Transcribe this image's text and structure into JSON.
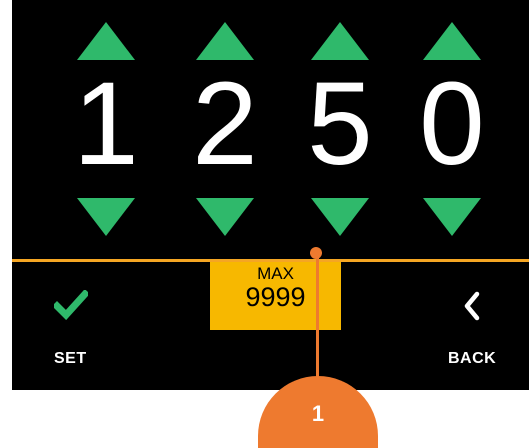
{
  "digits": [
    "1",
    "2",
    "5",
    "0"
  ],
  "max": {
    "label": "MAX",
    "value": "9999"
  },
  "buttons": {
    "set_label": "SET",
    "back_label": "BACK"
  },
  "callout": {
    "number": "1"
  },
  "colors": {
    "screen_bg": "#000000",
    "arrow_green": "#2fb96b",
    "check_green": "#2fb96b",
    "divider_orange": "#f5a623",
    "max_box_yellow": "#f7b800",
    "callout_orange": "#ee7a2f",
    "text_white": "#ffffff"
  },
  "icons": {
    "set": "checkmark-icon",
    "back": "chevron-left-icon",
    "increment": "triangle-up-icon",
    "decrement": "triangle-down-icon"
  }
}
